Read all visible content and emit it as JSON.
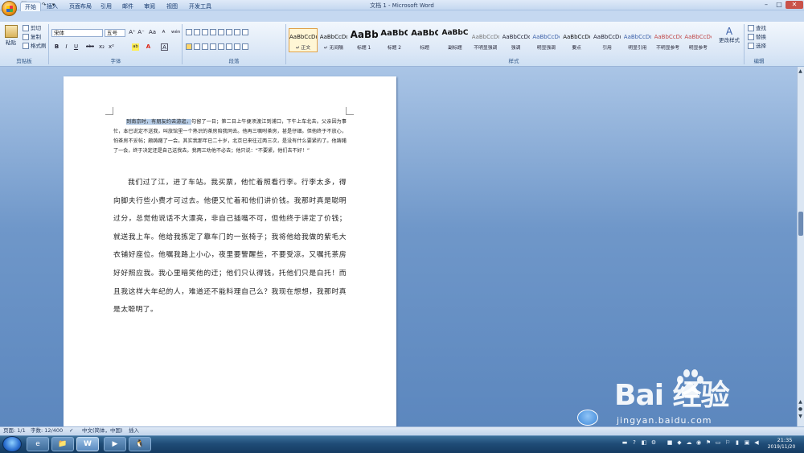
{
  "window": {
    "title": "文档 1 - Microsoft Word",
    "minimize": "–",
    "maximize": "□",
    "close": "✕"
  },
  "quick_access": [
    "💾",
    "↶",
    "↷",
    "▾"
  ],
  "tabs": [
    {
      "label": "开始",
      "active": true
    },
    {
      "label": "插入"
    },
    {
      "label": "页面布局"
    },
    {
      "label": "引用"
    },
    {
      "label": "邮件"
    },
    {
      "label": "审阅"
    },
    {
      "label": "视图"
    },
    {
      "label": "开发工具"
    }
  ],
  "ribbon": {
    "clipboard": {
      "paste": "粘贴",
      "cut": "剪切",
      "copy": "复制",
      "format_painter": "格式刷",
      "label": "剪贴板"
    },
    "font": {
      "name": "宋体",
      "size": "五号",
      "label": "字体",
      "bold": "B",
      "italic": "I",
      "underline": "U",
      "strike": "abc",
      "sub": "x₂",
      "sup": "x²",
      "change_case": "Aa",
      "grow": "A⁺",
      "shrink": "A⁻",
      "clear": "A",
      "font_color": "A",
      "highlight": "ab",
      "phonetic": "wén",
      "border_char": "A"
    },
    "paragraph": {
      "label": "段落"
    },
    "styles": {
      "label": "样式",
      "items": [
        {
          "preview": "AaBbCcDd",
          "name": "↵ 正文",
          "selected": true
        },
        {
          "preview": "AaBbCcDd",
          "name": "↵ 无间隔"
        },
        {
          "preview": "AaBb",
          "name": "标题 1"
        },
        {
          "preview": "AaBbC",
          "name": "标题 2"
        },
        {
          "preview": "AaBbC",
          "name": "标题"
        },
        {
          "preview": "AaBbC",
          "name": "副标题"
        },
        {
          "preview": "AaBbCcDd",
          "name": "不明显强调"
        },
        {
          "preview": "AaBbCcDd",
          "name": "强调"
        },
        {
          "preview": "AaBbCcDd",
          "name": "明显强调"
        },
        {
          "preview": "AaBbCcDd",
          "name": "要点"
        },
        {
          "preview": "AaBbCcDd",
          "name": "引用"
        },
        {
          "preview": "AaBbCcDd",
          "name": "明显引用"
        },
        {
          "preview": "AaBbCcDd",
          "name": "不明显参考"
        },
        {
          "preview": "AaBbCcDd",
          "name": "明显参考"
        }
      ],
      "change_styles": "更改样式"
    },
    "editing": {
      "find": "查找",
      "replace": "替换",
      "select": "选择",
      "label": "编辑"
    }
  },
  "document": {
    "p1_highlight": "到南京时，有朋友约去游逛，",
    "p1_rest": "勾留了一日；第二日上午便须渡江到浦口，下午上车北去。父亲因为事忙，本已说定不送我，叫旅馆里一个熟识的茶房陪我同去。他再三嘱咐茶房，甚是仔细。但他终于不放心，怕茶房不妥帖；颇踌躇了一会。其实我那年已二十岁，北京已来往过两三次，是没有什么要紧的了。他踌躇了一会，终于决定还是自己送我去。我两三劝他不必去；他只说：“不要紧，他们去不好！”",
    "p2": "我们过了江，进了车站。我买票，他忙着照看行李。行李太多，得向脚夫行些小费才可过去。他便又忙着和他们讲价钱。我那时真是聪明过分，总觉他说话不大漂亮，非自己插嘴不可，但他终于讲定了价钱；就送我上车。他给我拣定了靠车门的一张椅子；我将他给我做的紫毛大衣铺好座位。他嘱我路上小心，夜里要警醒些，不要受凉。又嘱托茶房好好照应我。我心里暗笑他的迂；他们只认得钱，托他们只是白托！而且我这样大年纪的人，难道还不能料理自己么？我现在想想，我那时真是太聪明了。"
  },
  "status": {
    "page": "页面: 1/1",
    "words": "字数: 12/400",
    "lang": "中文(简体，中国)",
    "mode": "插入"
  },
  "taskbar": {
    "time": "21:35",
    "date": "2019/11/20",
    "apps": [
      "e",
      "📁",
      "W",
      "▶",
      "🐧"
    ]
  },
  "watermark": {
    "logo": "Bai 经验",
    "url": "jingyan.baidu.com"
  }
}
